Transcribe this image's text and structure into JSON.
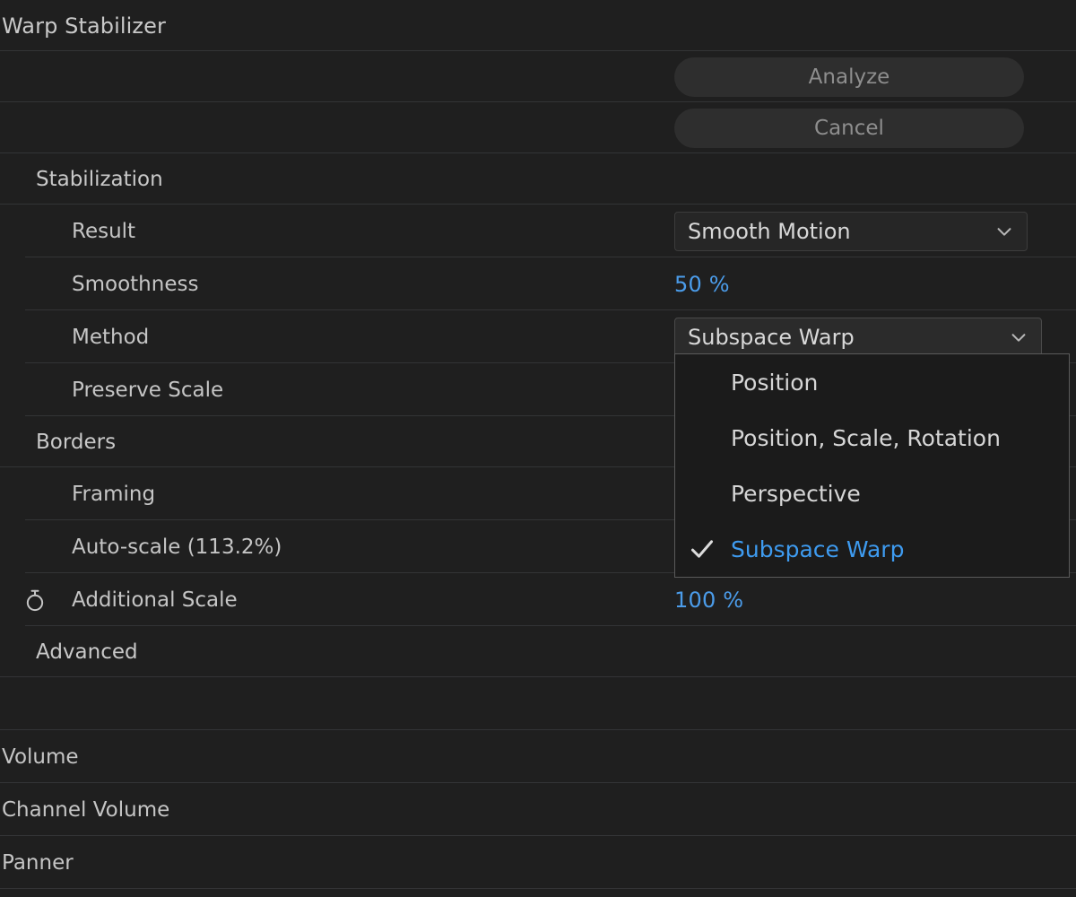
{
  "effect": {
    "title": "Warp Stabilizer",
    "buttons": [
      {
        "label": "Analyze",
        "name": "analyze-button"
      },
      {
        "label": "Cancel",
        "name": "cancel-button"
      }
    ],
    "groups": {
      "stabilization": "Stabilization",
      "borders": "Borders",
      "advanced": "Advanced"
    },
    "properties": {
      "result": {
        "label": "Result",
        "value": "Smooth Motion"
      },
      "smoothness": {
        "label": "Smoothness",
        "value": "50 %"
      },
      "method": {
        "label": "Method",
        "value": "Subspace Warp"
      },
      "preserve_scale": {
        "label": "Preserve Scale"
      },
      "framing": {
        "label": "Framing"
      },
      "auto_scale": {
        "label": "Auto-scale (113.2%)"
      },
      "additional_scale": {
        "label": "Additional Scale",
        "value": "100 %"
      }
    },
    "method_menu": {
      "options": [
        {
          "label": "Position",
          "selected": false
        },
        {
          "label": "Position, Scale, Rotation",
          "selected": false
        },
        {
          "label": "Perspective",
          "selected": false
        },
        {
          "label": "Subspace Warp",
          "selected": true
        }
      ]
    }
  },
  "other_effects": [
    {
      "label": "Volume"
    },
    {
      "label": "Channel Volume"
    },
    {
      "label": "Panner"
    }
  ],
  "colors": {
    "accent_blue": "#4b9cea",
    "panel_bg": "#1f1f1f",
    "menu_bg": "#1b1b1b",
    "text": "#c8c8c8",
    "disabled_text": "#8e8e8e",
    "separator": "#333436"
  }
}
